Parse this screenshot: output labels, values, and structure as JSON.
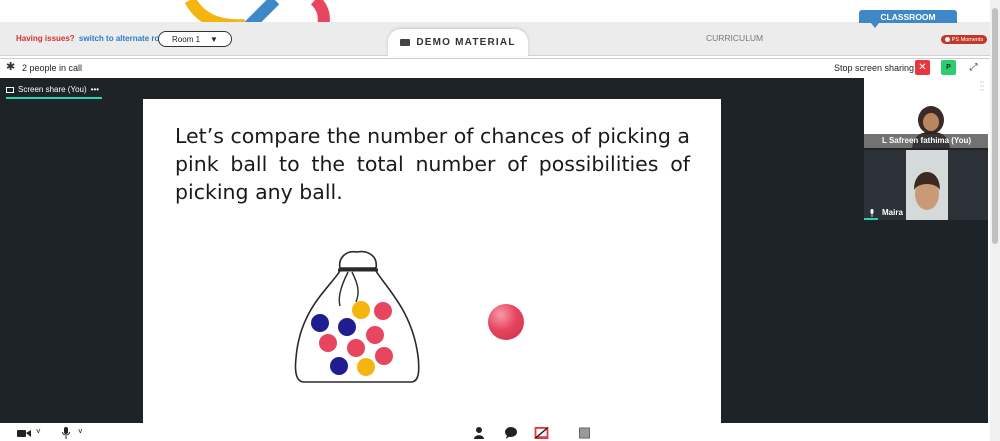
{
  "header": {
    "issues_question": "Having issues?",
    "issues_link": "switch to alternate room",
    "room_select": "Room 1",
    "demo_material_tab": "DEMO MATERIAL",
    "curriculum_tab": "CURRICULUM",
    "classroom_tab": "CLASSROOM",
    "ps_moments": "PS Moments"
  },
  "call": {
    "people_count": "2 people in call",
    "stop_sharing_label": "Stop screen sharing",
    "p_button_label": "P"
  },
  "share": {
    "tab_label": "Screen share (You)",
    "tab_menu": "•••",
    "slide_text": "Let’s compare the number of chances of picking a pink ball to the total number of possibilities of picking any ball."
  },
  "participants": [
    {
      "name": "L Safreen fathima (You)"
    },
    {
      "name": "Maira"
    }
  ],
  "colors": {
    "accent_blue": "#3e88c7",
    "stop_red": "#e8383f",
    "p_green": "#2ecc71",
    "active_teal": "#2bd2b0",
    "stage_bg": "#1e2328",
    "ball_pink": "#e8455f",
    "ball_navy": "#1f1d8f",
    "ball_gold": "#f5b50f"
  },
  "icons": {
    "settings": "gear-icon",
    "camera": "video-camera-icon",
    "mic": "microphone-icon",
    "participants": "person-icon",
    "chat": "chat-bubble-icon",
    "screen_share": "screen-share-off-icon",
    "whiteboard": "square-icon"
  }
}
